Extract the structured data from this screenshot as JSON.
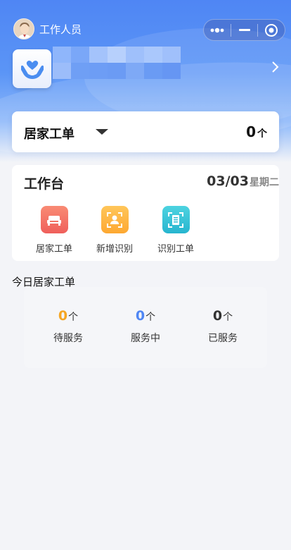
{
  "header": {
    "user_role": "工作人员",
    "avatar_icon": "person-avatar-icon",
    "capsule": {
      "more_icon": "more-dots-icon",
      "minimize_icon": "minimize-icon",
      "close_icon": "close-circle-icon"
    },
    "logo_icon": "hands-heart-icon",
    "name_obscured": true,
    "arrow_icon": "chevron-right-icon",
    "accent_color": "#4f86f4"
  },
  "order_card": {
    "title": "居家工单",
    "count": "0",
    "unit": "个",
    "dropdown_icon": "caret-down-icon"
  },
  "workbench": {
    "title": "工作台",
    "date": "03/03",
    "weekday": "星期二",
    "tools": [
      {
        "label": "居家工单",
        "icon": "bed-icon",
        "color": "#f26b62"
      },
      {
        "label": "新增识别",
        "icon": "face-scan-icon",
        "color": "#fdb33e"
      },
      {
        "label": "识别工单",
        "icon": "doc-scan-icon",
        "color": "#35c3d6"
      }
    ]
  },
  "today": {
    "title": "今日居家工单",
    "stats": [
      {
        "value": "0",
        "unit": "个",
        "label": "待服务",
        "color": "#f5a623"
      },
      {
        "value": "0",
        "unit": "个",
        "label": "服务中",
        "color": "#4f86f4"
      },
      {
        "value": "0",
        "unit": "个",
        "label": "已服务",
        "color": "#333333"
      }
    ]
  }
}
